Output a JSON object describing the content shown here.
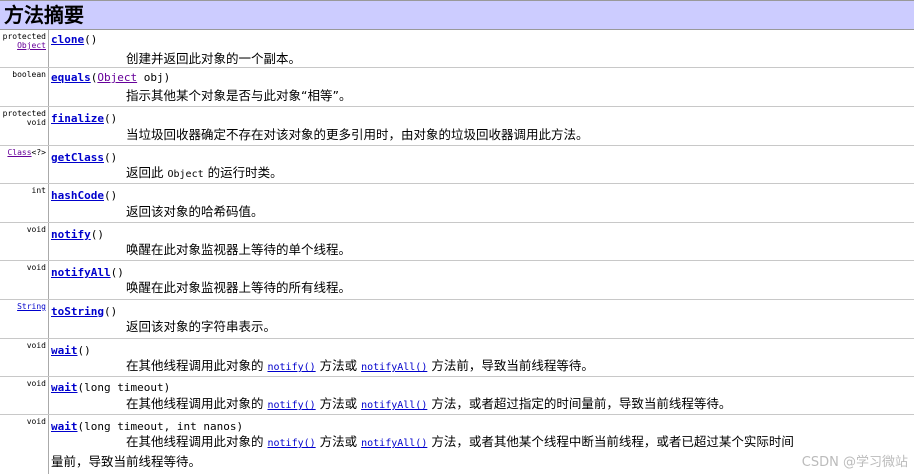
{
  "header": {
    "title": "方法摘要"
  },
  "rows": [
    {
      "mod1": "protected",
      "mod2": "Object",
      "name": "clone",
      "params": "()",
      "desc": "创建并返回此对象的一个副本。"
    },
    {
      "mod1": "boolean",
      "name": "equals",
      "params_open": "(",
      "ptype": "Object",
      "pname": " obj)",
      "desc": "指示其他某个对象是否与此对象“相等”。"
    },
    {
      "mod1": "protected",
      "mod2": "void",
      "name": "finalize",
      "params": "()",
      "desc": "当垃圾回收器确定不存在对该对象的更多引用时，由对象的垃圾回收器调用此方法。"
    },
    {
      "mod_link": "Class",
      "mod_rest": "<?>",
      "name": "getClass",
      "params": "()",
      "desc_a": "返回此 ",
      "desc_code": "Object",
      "desc_b": " 的运行时类。"
    },
    {
      "mod1": "int",
      "name": "hashCode",
      "params": "()",
      "desc": "返回该对象的哈希码值。"
    },
    {
      "mod1": "void",
      "name": "notify",
      "params": "()",
      "desc": "唤醒在此对象监视器上等待的单个线程。"
    },
    {
      "mod1": "void",
      "name": "notifyAll",
      "params": "()",
      "desc": "唤醒在此对象监视器上等待的所有线程。"
    },
    {
      "mod_link": "String",
      "name": "toString",
      "params": "()",
      "desc": "返回该对象的字符串表示。"
    },
    {
      "mod1": "void",
      "name": "wait",
      "params": "()",
      "desc_a": "在其他线程调用此对象的 ",
      "l1": "notify()",
      "desc_b": " 方法或 ",
      "l2": "notifyAll()",
      "desc_c": " 方法前，导致当前线程等待。"
    },
    {
      "mod1": "void",
      "name": "wait",
      "params": "(long timeout)",
      "desc_a": "在其他线程调用此对象的 ",
      "l1": "notify()",
      "desc_b": " 方法或 ",
      "l2": "notifyAll()",
      "desc_c": " 方法，或者超过指定的时间量前，导致当前线程等待。"
    },
    {
      "mod1": "void",
      "name": "wait",
      "params": "(long timeout, int nanos)",
      "desc_a": "在其他线程调用此对象的 ",
      "l1": "notify()",
      "desc_b": " 方法或 ",
      "l2": "notifyAll()",
      "desc_c": " 方法，或者其他某个线程中断当前线程，或者已超过某个实际时间",
      "desc_line2": "量前，导致当前线程等待。"
    }
  ],
  "watermark": "CSDN @学习微站"
}
